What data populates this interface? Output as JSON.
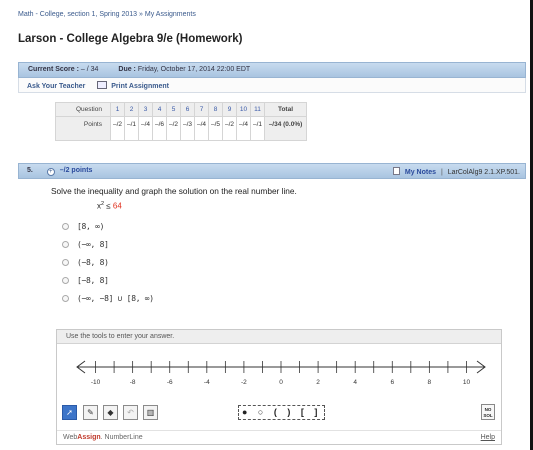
{
  "breadcrumb": {
    "course": "Math - College, section 1, Spring 2013",
    "sep": "»",
    "assignments": "My Assignments"
  },
  "title": "Larson - College Algebra 9/e (Homework)",
  "score": {
    "label": "Current Score :",
    "value": "– / 34",
    "due_label": "Due :",
    "due_value": "Friday, October 17, 2014 22:00 EDT"
  },
  "links": {
    "ask_teacher": "Ask Your Teacher",
    "print": "Print Assignment"
  },
  "score_table": {
    "question_label": "Question",
    "points_label": "Points",
    "questions": [
      "1",
      "2",
      "3",
      "4",
      "5",
      "6",
      "7",
      "8",
      "9",
      "10",
      "11"
    ],
    "points": [
      "–/2",
      "–/1",
      "–/4",
      "–/6",
      "–/2",
      "–/3",
      "–/4",
      "–/5",
      "–/2",
      "–/4",
      "–/1"
    ],
    "total_label": "Total",
    "total_value": "–/34 (0.0%)"
  },
  "question": {
    "number": "5.",
    "plus": "+",
    "points": "–/2 points",
    "my_notes": "My Notes",
    "sep": "|",
    "reference": "LarColAlg9 2.1.XP.501.",
    "prompt": "Solve the inequality and graph the solution on the real number line.",
    "ineq_var": "x",
    "ineq_exp": "2",
    "ineq_op": " ≤ ",
    "ineq_val": "64",
    "choices": [
      "[8, ∞)",
      "(−∞, 8]",
      "(−8, 8)",
      "[−8, 8]",
      "(−∞, −8] ∪ [8, ∞)"
    ]
  },
  "number_line": {
    "instructions": "Use the tools to enter your answer.",
    "min": -11,
    "max": 11,
    "tick_labels": [
      "-10",
      "-8",
      "-6",
      "-4",
      "-2",
      "0",
      "2",
      "4",
      "6",
      "8",
      "10"
    ],
    "endpoint_tools": "● ○ ( ) [ ]",
    "no_solution": "NO SOL",
    "brand_prefix": "Web",
    "brand_bold": "Assign",
    "brand_suffix": ". NumberLine",
    "help": "Help"
  }
}
